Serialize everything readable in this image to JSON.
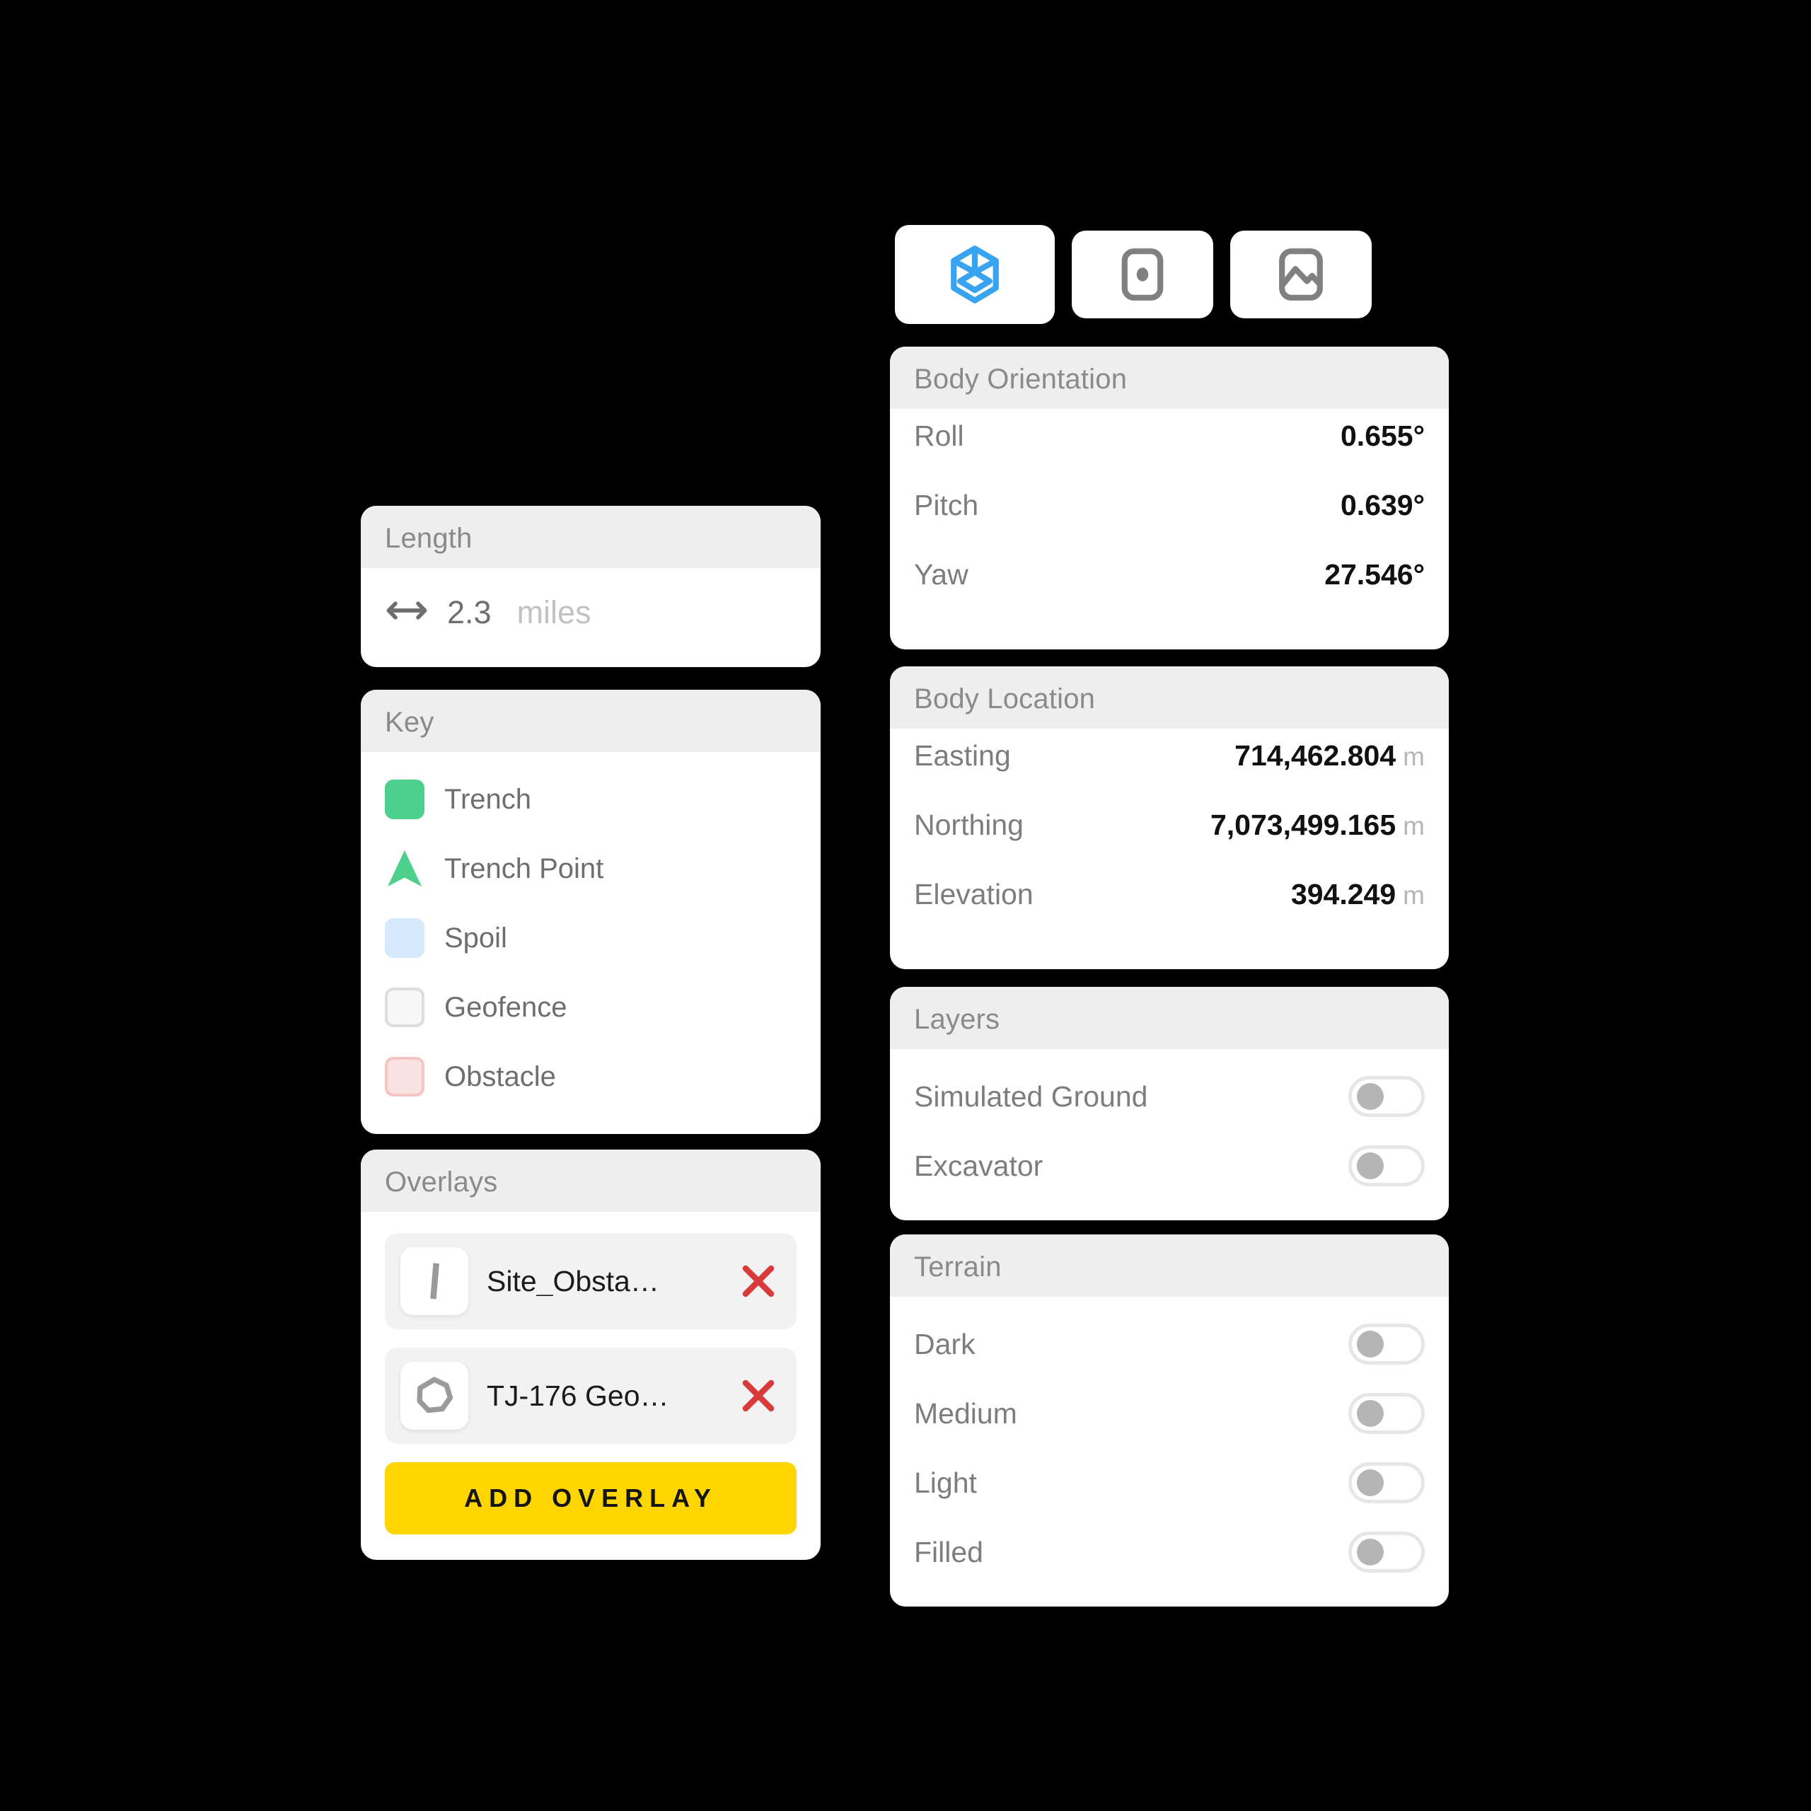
{
  "toolbar": {
    "buttons": [
      {
        "name": "3d-view",
        "icon": "cube-icon",
        "active": true,
        "color": "#38a3f0"
      },
      {
        "name": "plan-view",
        "icon": "point-in-frame-icon",
        "active": false,
        "color": "#808080"
      },
      {
        "name": "image-view",
        "icon": "image-icon",
        "active": false,
        "color": "#808080"
      }
    ]
  },
  "length_panel": {
    "title": "Length",
    "icon": "double-arrow-icon",
    "value": "2.3",
    "unit": "miles"
  },
  "key_panel": {
    "title": "Key",
    "items": [
      {
        "label": "Trench",
        "shape": "square",
        "color": "#4ed08d",
        "border": "#4ed08d"
      },
      {
        "label": "Trench Point",
        "shape": "arrow",
        "color": "#4ed08d",
        "border": "none"
      },
      {
        "label": "Spoil",
        "shape": "square",
        "color": "#d4e9fb",
        "border": "#d4e9fb"
      },
      {
        "label": "Geofence",
        "shape": "square",
        "color": "#f7f7f7",
        "border": "#dddddd"
      },
      {
        "label": "Obstacle",
        "shape": "square",
        "color": "#fbe2e2",
        "border": "#f2c4c4"
      }
    ]
  },
  "overlays_panel": {
    "title": "Overlays",
    "items": [
      {
        "name": "Site_Obsta…",
        "icon": "line-icon",
        "remove_label": "✕"
      },
      {
        "name": "TJ-176 Geo…",
        "icon": "polygon-icon",
        "remove_label": "✕"
      }
    ],
    "add_button_label": "ADD OVERLAY",
    "add_button_color": "#ffd500"
  },
  "body_orientation_panel": {
    "title": "Body Orientation",
    "rows": [
      {
        "label": "Roll",
        "value": "0.655°",
        "unit": ""
      },
      {
        "label": "Pitch",
        "value": "0.639°",
        "unit": ""
      },
      {
        "label": "Yaw",
        "value": "27.546°",
        "unit": ""
      }
    ]
  },
  "body_location_panel": {
    "title": "Body Location",
    "rows": [
      {
        "label": "Easting",
        "value": "714,462.804",
        "unit": "m"
      },
      {
        "label": "Northing",
        "value": "7,073,499.165",
        "unit": "m"
      },
      {
        "label": "Elevation",
        "value": "394.249",
        "unit": "m"
      }
    ]
  },
  "layers_panel": {
    "title": "Layers",
    "rows": [
      {
        "label": "Simulated Ground",
        "on": false
      },
      {
        "label": "Excavator",
        "on": false
      }
    ]
  },
  "terrain_panel": {
    "title": "Terrain",
    "rows": [
      {
        "label": "Dark",
        "on": false
      },
      {
        "label": "Medium",
        "on": false
      },
      {
        "label": "Light",
        "on": false
      },
      {
        "label": "Filled",
        "on": false
      }
    ]
  }
}
